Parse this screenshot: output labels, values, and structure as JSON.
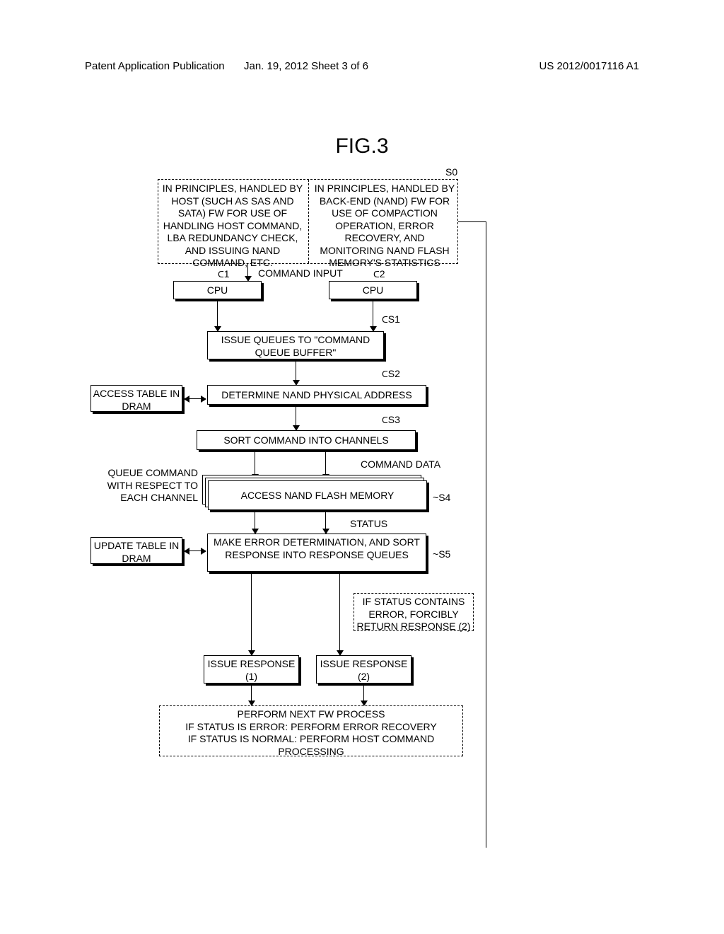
{
  "header": {
    "left": "Patent Application Publication",
    "mid": "Jan. 19, 2012  Sheet 3 of 6",
    "right": "US 2012/0017116 A1"
  },
  "figure_title": "FIG.3",
  "s0": {
    "label": "S0",
    "left_text": "IN PRINCIPLES, HANDLED BY HOST (SUCH AS SAS AND SATA) FW FOR USE OF HANDLING HOST COMMAND, LBA REDUNDANCY CHECK, AND ISSUING NAND COMMAND, ETC.",
    "right_text": "IN PRINCIPLES, HANDLED BY BACK-END (NAND) FW FOR USE OF COMPACTION OPERATION, ERROR RECOVERY, AND MONITORING NAND FLASH MEMORY'S STATISTICS"
  },
  "cmd_input": "COMMAND INPUT",
  "cpu1": {
    "label": "CPU",
    "ref": "1"
  },
  "cpu2": {
    "label": "CPU",
    "ref": "2"
  },
  "s1": {
    "label": "S1",
    "text": "ISSUE QUEUES TO \"COMMAND QUEUE BUFFER\""
  },
  "s2": {
    "label": "S2",
    "text": "DETERMINE NAND PHYSICAL ADDRESS"
  },
  "access_table": "ACCESS TABLE IN DRAM",
  "s3": {
    "label": "S3",
    "text": "SORT COMMAND INTO CHANNELS"
  },
  "cmd_data": "COMMAND DATA",
  "s4": {
    "label": "S4",
    "text": "ACCESS NAND FLASH MEMORY",
    "side": "QUEUE COMMAND WITH RESPECT TO EACH CHANNEL"
  },
  "status_lbl": "STATUS",
  "s5": {
    "label": "S5",
    "text": "MAKE ERROR DETERMINATION, AND SORT RESPONSE INTO RESPONSE QUEUES",
    "side": "UPDATE TABLE IN DRAM"
  },
  "err_note": "IF STATUS CONTAINS ERROR, FORCIBLY RETURN RESPONSE (2)",
  "resp1": "ISSUE RESPONSE (1)",
  "resp2": "ISSUE RESPONSE (2)",
  "final": {
    "line1": "PERFORM NEXT FW PROCESS",
    "line2": "IF STATUS IS ERROR: PERFORM ERROR RECOVERY",
    "line3": "IF STATUS IS NORMAL: PERFORM HOST COMMAND PROCESSING"
  },
  "chart_data": {
    "type": "flowchart",
    "nodes": [
      {
        "id": "S0",
        "type": "note-dashed",
        "text_left": "IN PRINCIPLES, HANDLED BY HOST (SUCH AS SAS AND SATA) FW FOR USE OF HANDLING HOST COMMAND, LBA REDUNDANCY CHECK, AND ISSUING NAND COMMAND, ETC.",
        "text_right": "IN PRINCIPLES, HANDLED BY BACK-END (NAND) FW FOR USE OF COMPACTION OPERATION, ERROR RECOVERY, AND MONITORING NAND FLASH MEMORY'S STATISTICS"
      },
      {
        "id": "CPU1",
        "type": "process",
        "text": "CPU",
        "ref": "1"
      },
      {
        "id": "CPU2",
        "type": "process",
        "text": "CPU",
        "ref": "2"
      },
      {
        "id": "S1",
        "type": "process",
        "text": "ISSUE QUEUES TO \"COMMAND QUEUE BUFFER\""
      },
      {
        "id": "S2",
        "type": "process",
        "text": "DETERMINE NAND PHYSICAL ADDRESS"
      },
      {
        "id": "AT",
        "type": "process",
        "text": "ACCESS TABLE IN DRAM"
      },
      {
        "id": "S3",
        "type": "process",
        "text": "SORT COMMAND INTO CHANNELS"
      },
      {
        "id": "S4",
        "type": "process-stack",
        "text": "ACCESS NAND FLASH MEMORY"
      },
      {
        "id": "S5",
        "type": "process",
        "text": "MAKE ERROR DETERMINATION, AND SORT RESPONSE INTO RESPONSE QUEUES"
      },
      {
        "id": "UT",
        "type": "process",
        "text": "UPDATE TABLE IN DRAM"
      },
      {
        "id": "ERRNOTE",
        "type": "note-dashed",
        "text": "IF STATUS CONTAINS ERROR, FORCIBLY RETURN RESPONSE (2)"
      },
      {
        "id": "R1",
        "type": "process",
        "text": "ISSUE RESPONSE (1)"
      },
      {
        "id": "R2",
        "type": "process",
        "text": "ISSUE RESPONSE (2)"
      },
      {
        "id": "FIN",
        "type": "note-dashed",
        "text": "PERFORM NEXT FW PROCESS / IF STATUS IS ERROR: PERFORM ERROR RECOVERY / IF STATUS IS NORMAL: PERFORM HOST COMMAND PROCESSING"
      }
    ],
    "edges": [
      {
        "from": "S0",
        "to": "CPU1",
        "label": "COMMAND INPUT"
      },
      {
        "from": "CPU1",
        "to": "S1"
      },
      {
        "from": "CPU2",
        "to": "S1"
      },
      {
        "from": "S1",
        "to": "S2"
      },
      {
        "from": "AT",
        "to": "S2",
        "bidir": true
      },
      {
        "from": "S2",
        "to": "S3"
      },
      {
        "from": "S3",
        "to": "S4",
        "label": "COMMAND DATA",
        "multi": true
      },
      {
        "from": "S4",
        "to": "S5",
        "label": "STATUS",
        "multi": true
      },
      {
        "from": "UT",
        "to": "S5",
        "bidir": true
      },
      {
        "from": "S5",
        "to": "R1"
      },
      {
        "from": "S5",
        "to": "R2"
      },
      {
        "from": "ERRNOTE",
        "to": "R2"
      },
      {
        "from": "R1",
        "to": "FIN"
      },
      {
        "from": "R2",
        "to": "FIN"
      }
    ]
  }
}
